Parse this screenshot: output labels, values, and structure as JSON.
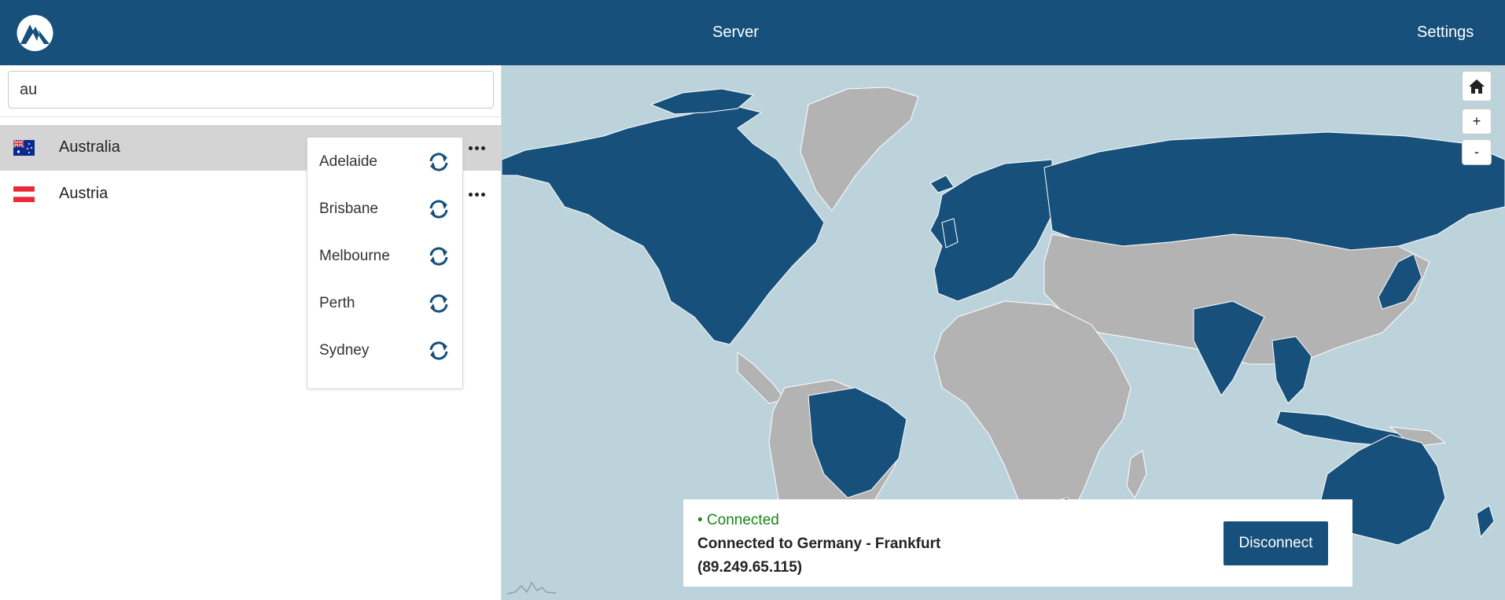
{
  "header": {
    "logo_icon": "mountain-logo-icon",
    "nav_server": "Server",
    "nav_settings": "Settings",
    "background": "#16507b"
  },
  "sidebar": {
    "search": {
      "value": "au"
    },
    "countries": [
      {
        "name": "Australia",
        "flag": "australia-flag",
        "selected": true
      },
      {
        "name": "Austria",
        "flag": "austria-flag",
        "selected": false
      }
    ],
    "more_icon": "more-dots-icon"
  },
  "city_dropdown": {
    "cities": [
      "Adelaide",
      "Brisbane",
      "Melbourne",
      "Perth",
      "Sydney"
    ],
    "action_icon": "reconnect-icon"
  },
  "map": {
    "home_icon": "home-icon",
    "zoom_in": "+",
    "zoom_out": "-",
    "colors": {
      "ocean": "#bcd3dc",
      "available": "#16507b",
      "unavailable": "#b3b3b3"
    }
  },
  "status": {
    "state": "• Connected",
    "line1": "Connected to Germany - Frankfurt",
    "line2": "(89.249.65.115)",
    "disconnect_label": "Disconnect",
    "state_color": "#178817"
  }
}
